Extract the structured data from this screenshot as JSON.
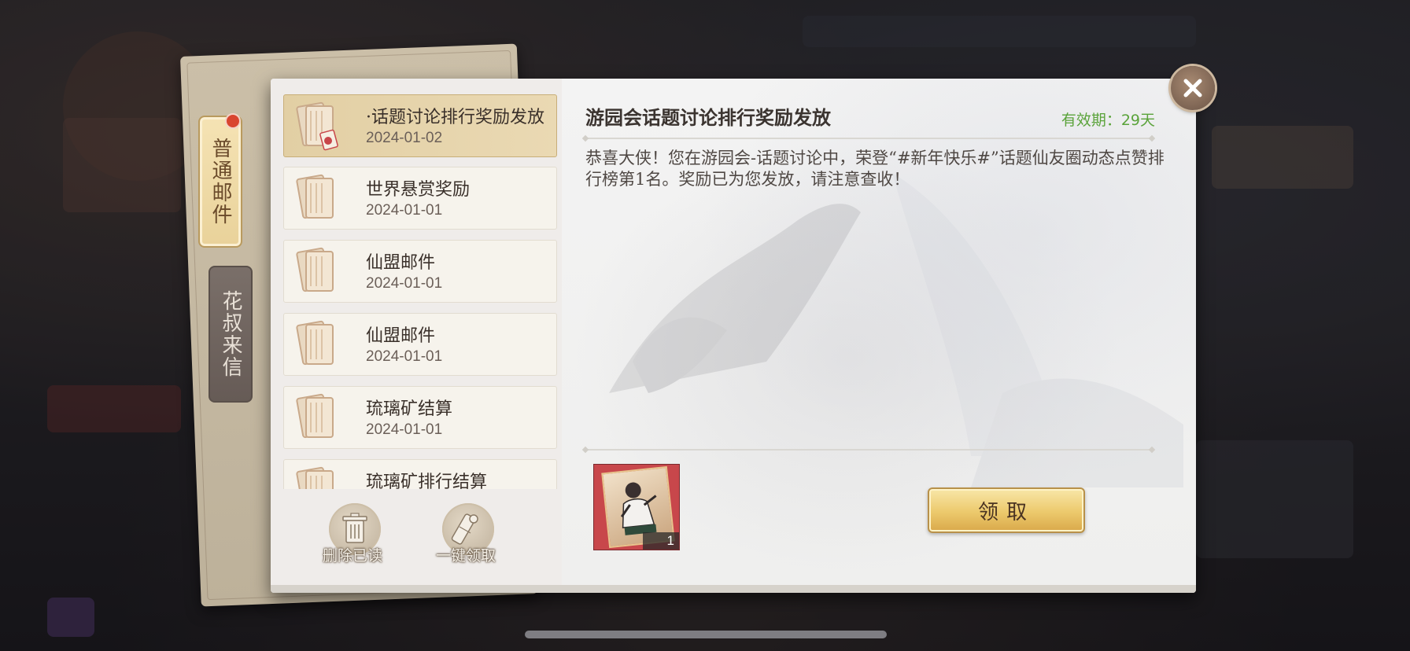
{
  "tabs": [
    {
      "label": "普通邮件",
      "active": true,
      "badge": true
    },
    {
      "label": "花叔来信",
      "active": false,
      "badge": false
    }
  ],
  "mail_list": [
    {
      "title": "·话题讨论排行奖励发放",
      "date": "2024-01-02",
      "selected": true
    },
    {
      "title": "世界悬赏奖励",
      "date": "2024-01-01",
      "selected": false
    },
    {
      "title": "仙盟邮件",
      "date": "2024-01-01",
      "selected": false
    },
    {
      "title": "仙盟邮件",
      "date": "2024-01-01",
      "selected": false
    },
    {
      "title": "琉璃矿结算",
      "date": "2024-01-01",
      "selected": false
    },
    {
      "title": "琉璃矿排行结算",
      "date": "",
      "selected": false
    }
  ],
  "list_actions": {
    "delete_read": "删除已读",
    "claim_all": "一键领取"
  },
  "mail_detail": {
    "title": "游园会话题讨论排行奖励发放",
    "expiry": "有效期：29天",
    "body": "恭喜大侠！您在游园会-话题讨论中，荣登“#新年快乐#”话题仙友圈动态点赞排行榜第1名。奖励已为您发放，请注意查收！",
    "reward": {
      "icon": "character-card-icon",
      "count": "1"
    },
    "claim_label": "领取"
  },
  "colors": {
    "expiry_green": "#5aa33a",
    "badge_red": "#d9452f",
    "selected_item": "#e2cfa4",
    "claim_gold": "#ecc96c"
  }
}
